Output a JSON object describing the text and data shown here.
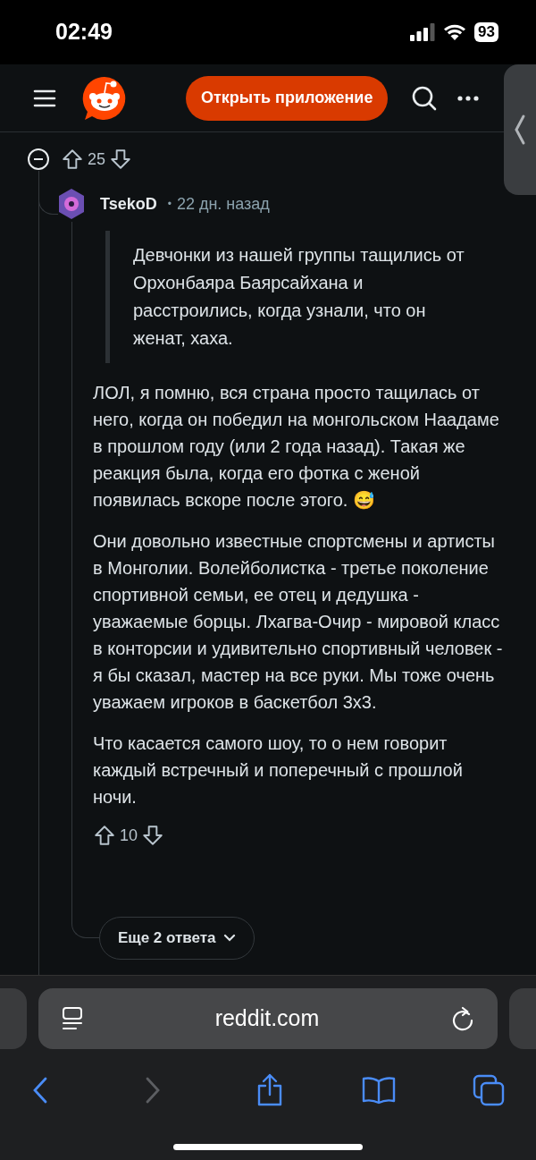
{
  "status_bar": {
    "time": "02:49",
    "battery": "93"
  },
  "header": {
    "open_app_button": "Открыть приложение"
  },
  "comment_votes": {
    "score": "25"
  },
  "reply": {
    "author": "TsekoD",
    "separator": "•",
    "time": "22 дн. назад",
    "quote": "Девчонки из нашей группы тащились от Орхонбаяра Баярсайхана и расстроились, когда узнали, что он женат, хаха.",
    "paragraphs": [
      "ЛОЛ, я помню, вся страна просто тащилась от него, когда он победил на монгольском Наадаме в прошлом году (или 2 года назад). Такая же реакция была, когда его фотка с женой появилась вскоре после этого. 😅",
      "Они довольно известные спортсмены и артисты в Монголии. Волейболистка - третье поколение спортивной семьи, ее отец и дедушка - уважаемые борцы. Лхагва-Очир - мировой класс в конторсии и удивительно спортивный человек - я бы сказал, мастер на все руки. Мы тоже очень уважаем игроков в баскетбол 3x3.",
      "Что касается самого шоу, то о нем говорит каждый встречный и поперечный с прошлой ночи."
    ],
    "score": "10"
  },
  "more_replies": "Еще 2 ответа",
  "browser": {
    "url": "reddit.com"
  }
}
